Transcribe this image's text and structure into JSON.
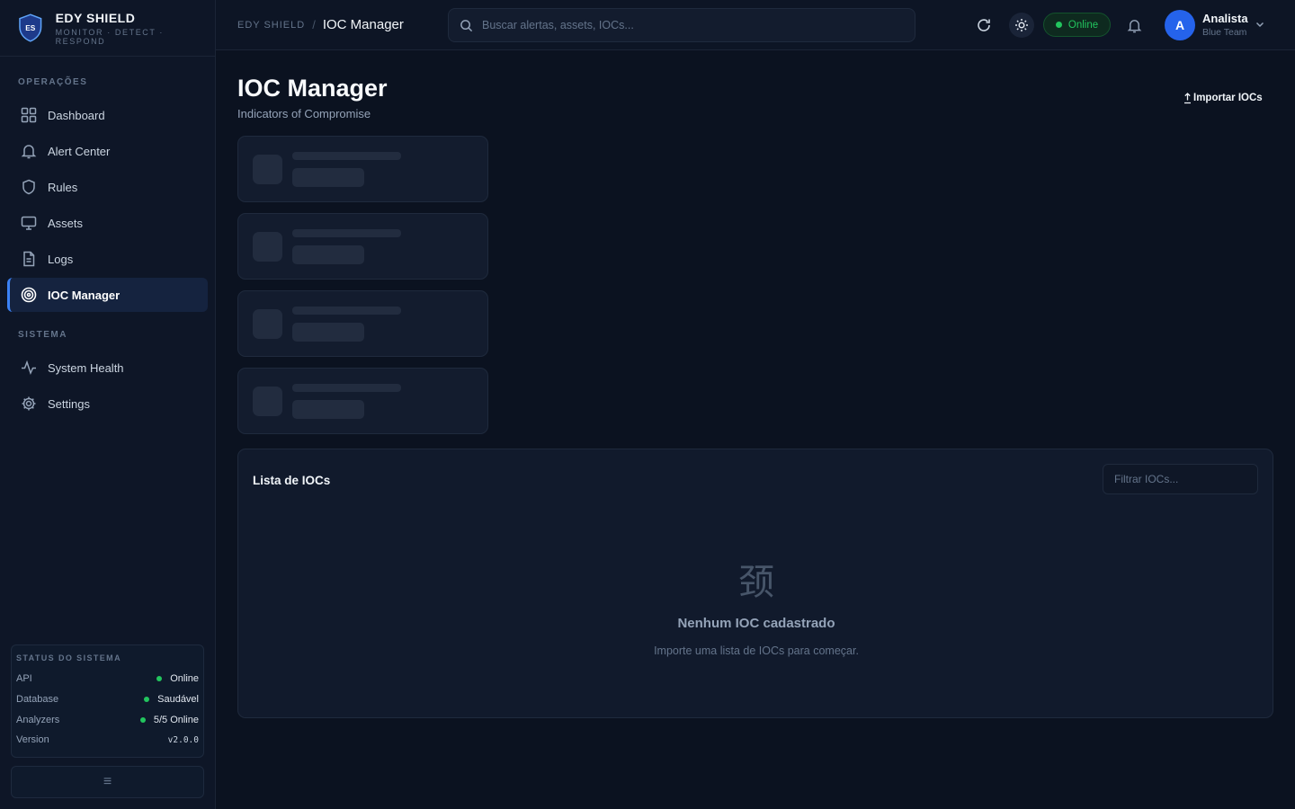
{
  "brand": {
    "name": "EDY SHIELD",
    "tagline": "MONITOR · DETECT · RESPOND",
    "logo_text": "ES"
  },
  "sidebar": {
    "section_ops": "OPERAÇÕES",
    "section_sys": "SISTEMA",
    "items": [
      {
        "label": "Dashboard",
        "icon": "grid-icon"
      },
      {
        "label": "Alert Center",
        "icon": "bell-icon"
      },
      {
        "label": "Rules",
        "icon": "shield-icon"
      },
      {
        "label": "Assets",
        "icon": "monitor-icon"
      },
      {
        "label": "Logs",
        "icon": "file-icon"
      },
      {
        "label": "IOC Manager",
        "icon": "target-icon",
        "active": true
      },
      {
        "label": "System Health",
        "icon": "activity-icon"
      },
      {
        "label": "Settings",
        "icon": "gear-icon"
      }
    ],
    "status": {
      "title": "STATUS DO SISTEMA",
      "rows": [
        {
          "label": "API",
          "value": "Online"
        },
        {
          "label": "Database",
          "value": "Saudável"
        },
        {
          "label": "Analyzers",
          "value": "5/5 Online"
        },
        {
          "label": "Version",
          "value": "v2.0.0"
        }
      ]
    },
    "collapse_icon": "≡"
  },
  "header": {
    "breadcrumb_root": "EDY SHIELD",
    "breadcrumb_sep": "/",
    "breadcrumb_current": "IOC Manager",
    "search_placeholder": "Buscar alertas, assets, IOCs...",
    "status_pill": "Online",
    "user": {
      "initial": "A",
      "name": "Analista",
      "role": "Blue Team"
    }
  },
  "page": {
    "title": "IOC Manager",
    "subtitle": "Indicators of Compromise",
    "import_label": "Importar IOCs",
    "list": {
      "title": "Lista de IOCs",
      "filter_placeholder": "Filtrar IOCs...",
      "empty_icon": "颈",
      "empty_title": "Nenhum IOC cadastrado",
      "empty_sub": "Importe uma lista de IOCs para começar."
    }
  },
  "colors": {
    "accent": "#3b82f6",
    "success": "#22c55e",
    "background": "#0b1220"
  }
}
